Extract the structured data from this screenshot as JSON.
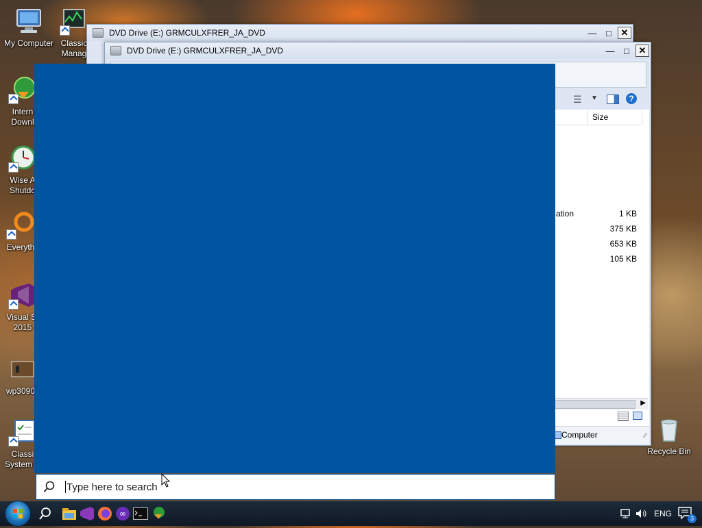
{
  "desktop": {
    "icons": [
      {
        "label": "My Computer"
      },
      {
        "label": "Classic Manag"
      },
      {
        "label": "Intern Downl"
      },
      {
        "label": "Wise A Shutdo"
      },
      {
        "label": "Everyth"
      },
      {
        "label": "Visual St 2015"
      },
      {
        "label": "wp3090"
      },
      {
        "label": "Classi System C"
      },
      {
        "label": "Recycle Bin"
      }
    ]
  },
  "window_back": {
    "title": "DVD Drive (E:) GRMCULXFRER_JA_DVD"
  },
  "window_front": {
    "title": "DVD Drive (E:) GRMCULXFRER_JA_DVD",
    "column_size": "Size",
    "rows": [
      {
        "type_partial": "ation",
        "size": "1 KB"
      },
      {
        "type_partial": "",
        "size": "375 KB"
      },
      {
        "type_partial": "",
        "size": "653 KB"
      },
      {
        "type_partial": "",
        "size": "105 KB"
      }
    ],
    "status_location": "Computer"
  },
  "start_menu": {
    "search_placeholder": "Type here to search"
  },
  "taskbar": {
    "language": "ENG",
    "notification_count": "3"
  },
  "colors": {
    "start_panel": "#0054a0",
    "taskbar": "#14202d"
  }
}
